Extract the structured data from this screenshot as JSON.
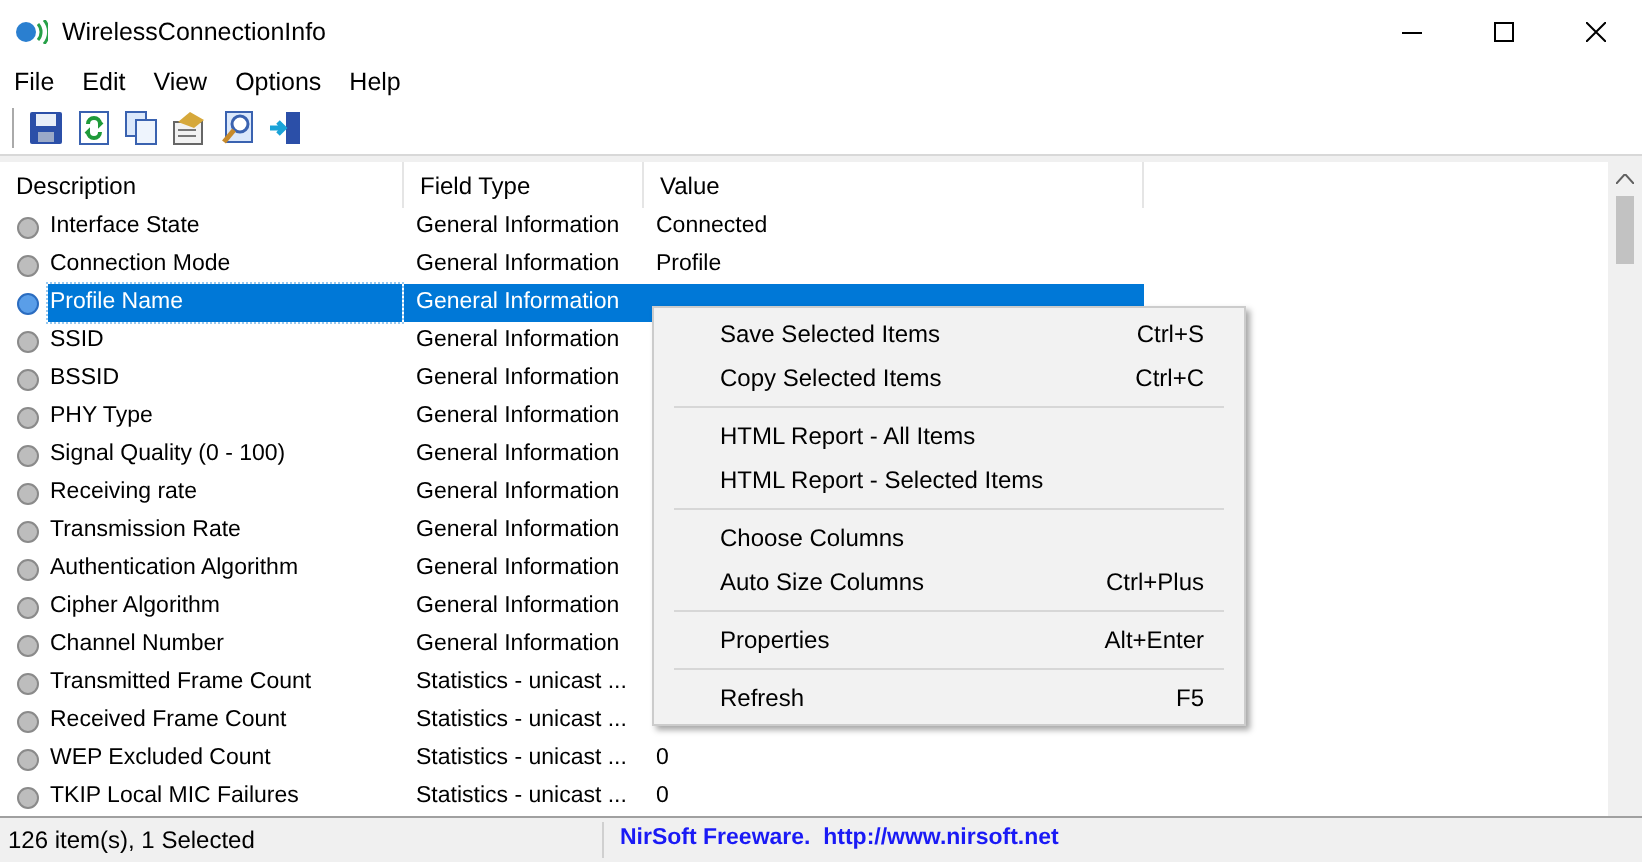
{
  "window": {
    "title": "WirelessConnectionInfo"
  },
  "menu_bar": [
    "File",
    "Edit",
    "View",
    "Options",
    "Help"
  ],
  "toolbar": [
    {
      "kind": "save"
    },
    {
      "kind": "refresh"
    },
    {
      "kind": "copy"
    },
    {
      "kind": "html"
    },
    {
      "kind": "properties"
    },
    {
      "kind": "exit"
    }
  ],
  "table": {
    "columns": [
      "Description",
      "Field Type",
      "Value"
    ],
    "rows": [
      {
        "description": "Interface State",
        "field_type": "General Information",
        "value": "Connected",
        "selected": false
      },
      {
        "description": "Connection Mode",
        "field_type": "General Information",
        "value": "Profile",
        "selected": false
      },
      {
        "description": "Profile Name",
        "field_type": "General Information",
        "selected": true
      },
      {
        "description": "SSID",
        "field_type": "General Information",
        "selected": false
      },
      {
        "description": "BSSID",
        "field_type": "General Information",
        "selected": false
      },
      {
        "description": "PHY Type",
        "field_type": "General Information",
        "selected": false
      },
      {
        "description": "Signal Quality (0 - 100)",
        "field_type": "General Information",
        "selected": false
      },
      {
        "description": "Receiving rate",
        "field_type": "General Information",
        "selected": false
      },
      {
        "description": "Transmission Rate",
        "field_type": "General Information",
        "selected": false
      },
      {
        "description": "Authentication Algorithm",
        "field_type": "General Information",
        "selected": false
      },
      {
        "description": "Cipher Algorithm",
        "field_type": "General Information",
        "selected": false
      },
      {
        "description": "Channel Number",
        "field_type": "General Information",
        "selected": false
      },
      {
        "description": "Transmitted Frame Count",
        "field_type": "Statistics - unicast ...",
        "selected": false
      },
      {
        "description": "Received Frame Count",
        "field_type": "Statistics - unicast ...",
        "selected": false
      },
      {
        "description": "WEP Excluded Count",
        "field_type": "Statistics - unicast ...",
        "value": "0",
        "selected": false
      },
      {
        "description": "TKIP Local MIC Failures",
        "field_type": "Statistics - unicast ...",
        "value": "0",
        "selected": false
      }
    ]
  },
  "context_menu": [
    {
      "kind": "item",
      "label": "Save Selected Items",
      "shortcut": "Ctrl+S"
    },
    {
      "kind": "item",
      "label": "Copy Selected Items",
      "shortcut": "Ctrl+C"
    },
    {
      "kind": "separator"
    },
    {
      "kind": "item",
      "label": "HTML Report - All Items"
    },
    {
      "kind": "item",
      "label": "HTML Report - Selected Items"
    },
    {
      "kind": "separator"
    },
    {
      "kind": "item",
      "label": "Choose Columns"
    },
    {
      "kind": "item",
      "label": "Auto Size Columns",
      "shortcut": "Ctrl+Plus"
    },
    {
      "kind": "separator"
    },
    {
      "kind": "item",
      "label": "Properties",
      "shortcut": "Alt+Enter"
    },
    {
      "kind": "separator"
    },
    {
      "kind": "item",
      "label": "Refresh",
      "shortcut": "F5"
    }
  ],
  "status_bar": {
    "count": "126 item(s), 1 Selected",
    "link": "NirSoft Freeware.  http://www.nirsoft.net"
  }
}
